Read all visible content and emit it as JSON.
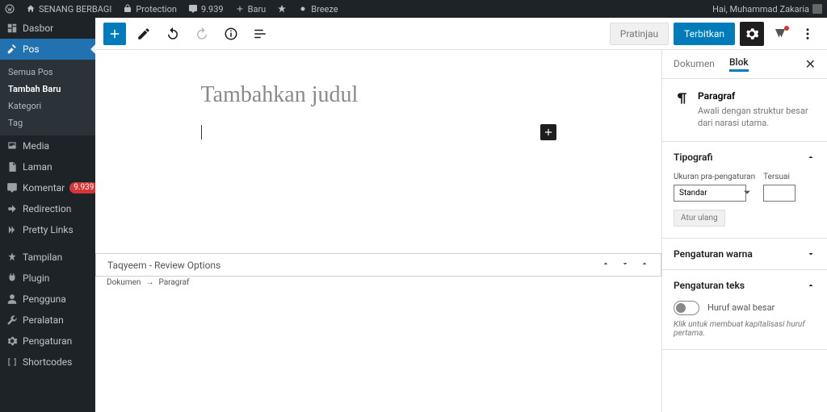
{
  "adminbar": {
    "site": "SENANG BERBAGI",
    "protection": "Protection",
    "comments": "9.939",
    "new": "Baru",
    "breeze": "Breeze",
    "greeting": "Hai, Muhammad Zakaria"
  },
  "sidebar": {
    "dasbor": "Dasbor",
    "pos": "Pos",
    "pos_sub": {
      "semua": "Semua Pos",
      "tambah": "Tambah Baru",
      "kategori": "Kategori",
      "tag": "Tag"
    },
    "media": "Media",
    "laman": "Laman",
    "komentar": "Komentar",
    "komentar_badge": "9.939",
    "redirection": "Redirection",
    "pretty": "Pretty Links",
    "tampilan": "Tampilan",
    "plugin": "Plugin",
    "pengguna": "Pengguna",
    "peralatan": "Peralatan",
    "pengaturan": "Pengaturan",
    "shortcodes": "Shortcodes"
  },
  "editor": {
    "preview": "Pratinjau",
    "publish": "Terbitkan",
    "title_placeholder": "Tambahkan judul",
    "metabox_title": "Taqyeem - Review Options",
    "breadcrumb": {
      "a": "Dokumen",
      "b": "Paragraf"
    }
  },
  "panel": {
    "tab_doc": "Dokumen",
    "tab_block": "Blok",
    "block_name": "Paragraf",
    "block_desc": "Awali dengan struktur besar dari narasi utama.",
    "typography": "Tipografi",
    "size_preset_label": "Ukuran pra-pengaturan",
    "custom_label": "Tersuai",
    "size_value": "Standar",
    "reset": "Atur ulang",
    "color_settings": "Pengaturan warna",
    "text_settings": "Pengaturan teks",
    "drop_cap": "Huruf awal besar",
    "drop_cap_desc": "Klik untuk membuat kapitalisasi huruf pertama."
  }
}
